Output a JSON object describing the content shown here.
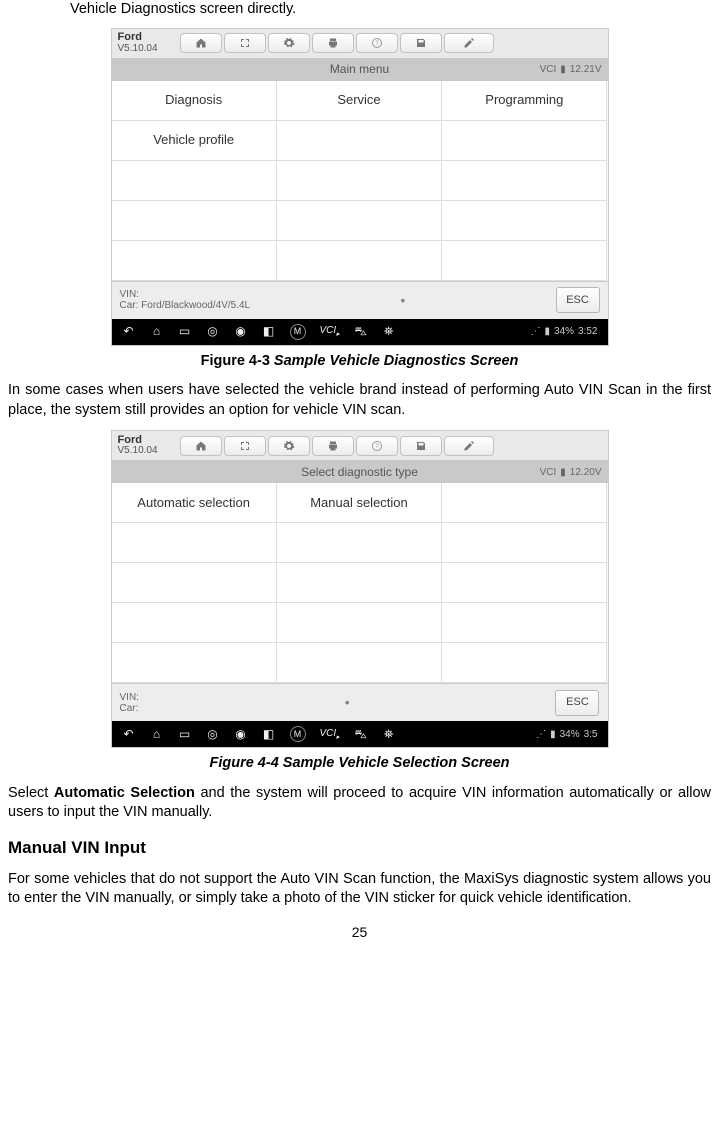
{
  "fragment": "Vehicle Diagnostics screen directly.",
  "figure43": {
    "brand": "Ford",
    "version": "V5.10.04",
    "title": "Main menu",
    "vci_label": "VCI",
    "voltage": "12.21V",
    "cells": [
      "Diagnosis",
      "Service",
      "Programming",
      "Vehicle profile"
    ],
    "vin_label": "VIN:",
    "car_label": "Car: Ford/Blackwood/4V/5.4L",
    "esc": "ESC",
    "battery": "34%",
    "time": "3:52"
  },
  "caption43_a": "Figure 4-3 ",
  "caption43_b": "Sample Vehicle Diagnostics Screen",
  "para1": "In some cases when users have selected the vehicle brand instead of performing Auto VIN Scan in the first place, the system still provides an option for vehicle VIN scan.",
  "figure44": {
    "brand": "Ford",
    "version": "V5.10.04",
    "title": "Select diagnostic type",
    "vci_label": "VCI",
    "voltage": "12.20V",
    "cells": [
      "Automatic selection",
      "Manual selection"
    ],
    "vin_label": "VIN:",
    "car_label": "Car:",
    "esc": "ESC",
    "battery": "34%",
    "time": "3:5"
  },
  "caption44": "Figure 4-4 Sample Vehicle Selection Screen",
  "para2_a": "Select ",
  "para2_b": "Automatic Selection",
  "para2_c": " and the system will proceed to acquire VIN information automatically or allow users to input the VIN manually.",
  "subhead": "Manual VIN Input",
  "para3": "For some vehicles that do not support the Auto VIN Scan function, the MaxiSys diagnostic system allows you to enter the VIN manually, or simply take a photo of the VIN sticker for quick vehicle identification.",
  "page": "25",
  "nav_icons": {
    "back": "←",
    "home": "⌂",
    "recent": "▭",
    "browser": "◐",
    "camera": "⧀",
    "volume": "◧",
    "m_label": "M",
    "vci": "VCI",
    "car": "⛍",
    "people": "⛯"
  }
}
